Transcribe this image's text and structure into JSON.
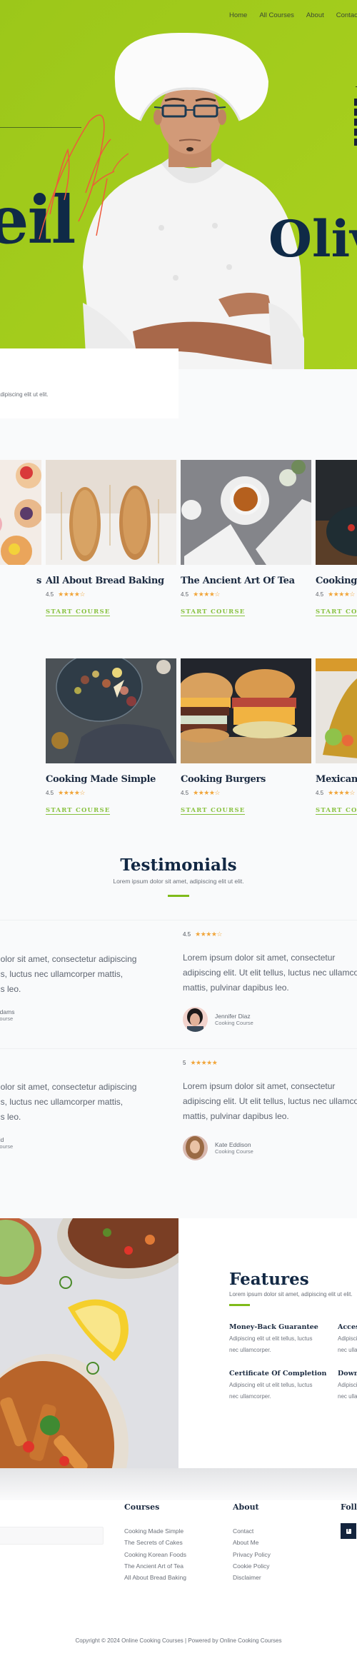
{
  "nav": {
    "items": [
      "Home",
      "All Courses",
      "About",
      "Contact"
    ]
  },
  "hero": {
    "word_left": "eil",
    "word_right": "Oliv",
    "signature": "Olyle",
    "card_text": "adipiscing elit ut elit."
  },
  "courses": [
    {
      "title": "s",
      "rating": "",
      "stars": "",
      "cta": "",
      "image": "cupcakes-photo"
    },
    {
      "title": "All About Bread Baking",
      "rating": "4.5",
      "stars": "★★★★☆",
      "cta": "START COURSE",
      "image": "bread-photo"
    },
    {
      "title": "The Ancient Art Of Tea",
      "rating": "4.5",
      "stars": "★★★★☆",
      "cta": "START COURSE",
      "image": "tea-photo"
    },
    {
      "title": "Cooking I",
      "rating": "4.5",
      "stars": "★★★★☆",
      "cta": "START COUR",
      "image": "korean-food-photo"
    },
    {
      "title": "Cooking Made Simple",
      "rating": "4.5",
      "stars": "★★★★☆",
      "cta": "START COURSE",
      "image": "platter-photo"
    },
    {
      "title": "Cooking Burgers",
      "rating": "4.5",
      "stars": "★★★★☆",
      "cta": "START COURSE",
      "image": "burgers-photo"
    },
    {
      "title": "Mexican",
      "rating": "4.5",
      "stars": "★★★★☆",
      "cta": "START COUR",
      "image": "tacos-photo"
    }
  ],
  "testimonials": {
    "title": "Testimonials",
    "subtitle": "Lorem ipsum dolor sit amet, adipiscing elit ut elit.",
    "items": [
      {
        "rating": "",
        "stars": "",
        "quote_lines": [
          "dolor sit amet, consectetur adipiscing",
          "us, luctus nec ullamcorper mattis,",
          "us leo."
        ],
        "name": "Adams",
        "role": "Course"
      },
      {
        "rating": "4.5",
        "stars": "★★★★☆",
        "quote": "Lorem ipsum dolor sit amet, consectetur adipiscing elit. Ut elit tellus, luctus nec ullamcorper mattis, pulvinar dapibus leo.",
        "name": "Jennifer Diaz",
        "role": "Cooking Course"
      },
      {
        "rating": "",
        "stars": "",
        "quote_lines": [
          "dolor sit amet, consectetur adipiscing",
          "us, luctus nec ullamcorper mattis,",
          "us leo."
        ],
        "name": "old",
        "role": "Course"
      },
      {
        "rating": "5",
        "stars": "★★★★★",
        "quote": "Lorem ipsum dolor sit amet, consectetur adipiscing elit. Ut elit tellus, luctus nec ullamcorper mattis, pulvinar dapibus leo.",
        "name": "Kate Eddison",
        "role": "Cooking Course"
      }
    ]
  },
  "features": {
    "title": "Features",
    "subtitle": "Lorem ipsum dolor sit amet, adipiscing elit ut elit.",
    "items": [
      {
        "title": "Money-Back Guarantee",
        "text": "Adipiscing elit ut elit tellus, luctus nec ullamcorper."
      },
      {
        "title": "Access",
        "text": "Adipiscing elit ut elit tellus, luctus nec ullamcorper."
      },
      {
        "title": "Certificate Of Completion",
        "text": "Adipiscing elit ut elit tellus, luctus nec ullamcorper."
      },
      {
        "title": "Download",
        "text": "Adipiscing elit ut elit tellus, luctus nec ullamcorper."
      }
    ]
  },
  "footer": {
    "courses_title": "Courses",
    "courses": [
      "Cooking Made Simple",
      "The Secrets of Cakes",
      "Cooking Korean Foods",
      "The Ancient Art of Tea",
      "All About Bread Baking"
    ],
    "about_title": "About",
    "about": [
      "Contact",
      "About Me",
      "Privacy Policy",
      "Cookie Policy",
      "Disclaimer"
    ],
    "follow_title": "Follow",
    "social": [
      "facebook-icon"
    ],
    "copyright": "Copyright © 2024 Online Cooking Courses | Powered by Online Cooking Courses"
  },
  "colors": {
    "accent_green": "#7fbb1a",
    "hero_green": "#a3cc1c",
    "navy": "#122844",
    "star": "#f1a53a",
    "cta": "#88c23f"
  }
}
